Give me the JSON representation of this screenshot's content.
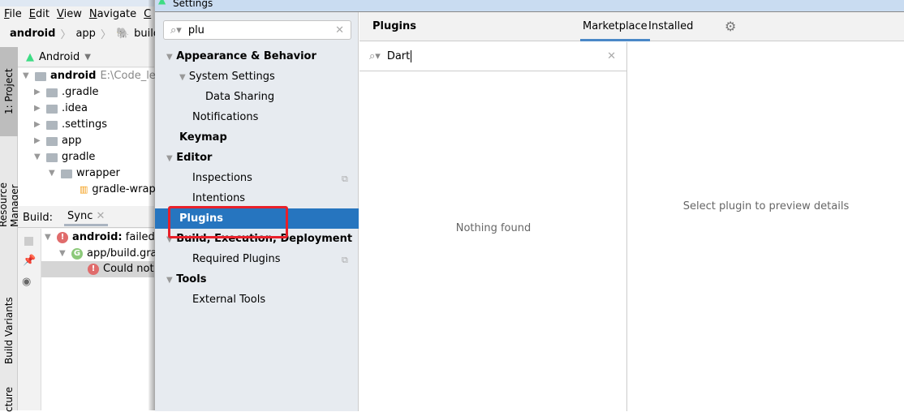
{
  "ide": {
    "menu": [
      "File",
      "Edit",
      "View",
      "Navigate",
      "C"
    ],
    "breadcrumb": [
      "android",
      "app",
      "build.gra"
    ],
    "side_tabs": {
      "project": "1: Project",
      "resource_manager": "Resource Manager",
      "build_variants": "Build Variants",
      "structure": "cture"
    },
    "project_view": "Android",
    "tree": [
      {
        "label": "android",
        "path": "E:\\Code_lea",
        "bold": true,
        "expanded": true,
        "depth": 0
      },
      {
        "label": ".gradle",
        "depth": 1
      },
      {
        "label": ".idea",
        "depth": 1
      },
      {
        "label": ".settings",
        "depth": 1
      },
      {
        "label": "app",
        "depth": 1
      },
      {
        "label": "gradle",
        "depth": 1,
        "expanded": true
      },
      {
        "label": "wrapper",
        "depth": 2,
        "expanded": true
      },
      {
        "label": "gradle-wrap",
        "depth": 3
      }
    ],
    "build": {
      "label": "Build:",
      "tab": "Sync",
      "rows": [
        {
          "bold": "android:",
          "text": " failed a"
        },
        {
          "text": "app/build.gra"
        },
        {
          "text": "Could not"
        }
      ]
    }
  },
  "dialog": {
    "title": "Settings",
    "search": {
      "value": "plu"
    },
    "tree": [
      {
        "label": "Appearance & Behavior",
        "bold": true,
        "arrow": true
      },
      {
        "label": "System Settings",
        "arrow": true
      },
      {
        "label": "Data Sharing"
      },
      {
        "label": "Notifications"
      },
      {
        "label": "Keymap",
        "bold": true
      },
      {
        "label": "Editor",
        "bold": true,
        "arrow": true
      },
      {
        "label": "Inspections",
        "copy": true
      },
      {
        "label": "Intentions"
      },
      {
        "label": "Plugins",
        "bold": true,
        "selected": true
      },
      {
        "label": "Build, Execution, Deployment",
        "bold": true,
        "arrow": true
      },
      {
        "label": "Required Plugins",
        "copy": true
      },
      {
        "label": "Tools",
        "bold": true,
        "arrow": true
      },
      {
        "label": "External Tools"
      }
    ],
    "plugins": {
      "title": "Plugins",
      "tabs": [
        "Marketplace",
        "Installed"
      ],
      "active_tab": "Marketplace",
      "search_value": "Dart",
      "empty": "Nothing found",
      "detail_placeholder": "Select plugin to preview details"
    },
    "colors": {
      "selection": "#2675bf",
      "highlight_box": "#e8202a",
      "tab_underline": "#4a88c7"
    }
  }
}
